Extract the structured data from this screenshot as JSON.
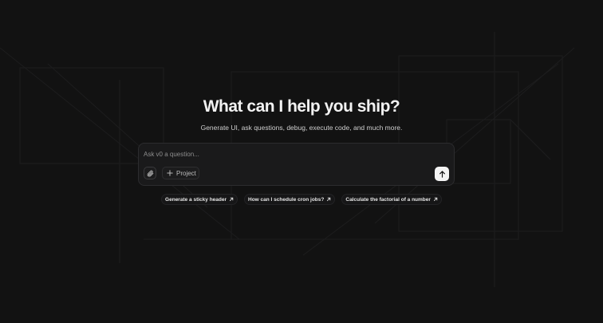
{
  "hero": {
    "title": "What can I help you ship?",
    "subtitle": "Generate UI, ask questions, debug, execute code, and much more."
  },
  "prompt": {
    "placeholder": "Ask v0 a question...",
    "value": "",
    "attach_icon": "paperclip-icon",
    "project_label": "Project",
    "project_icon": "plus-icon",
    "send_icon": "arrow-up-icon"
  },
  "suggestions": [
    {
      "label": "Generate a sticky header",
      "icon": "arrow-up-right-icon"
    },
    {
      "label": "How can I schedule cron jobs?",
      "icon": "arrow-up-right-icon"
    },
    {
      "label": "Calculate the factorial of a number",
      "icon": "arrow-up-right-icon"
    }
  ],
  "colors": {
    "background": "#121212",
    "surface": "#1a1a1b",
    "text": "#ededed",
    "send_button": "#f4f4f4"
  }
}
